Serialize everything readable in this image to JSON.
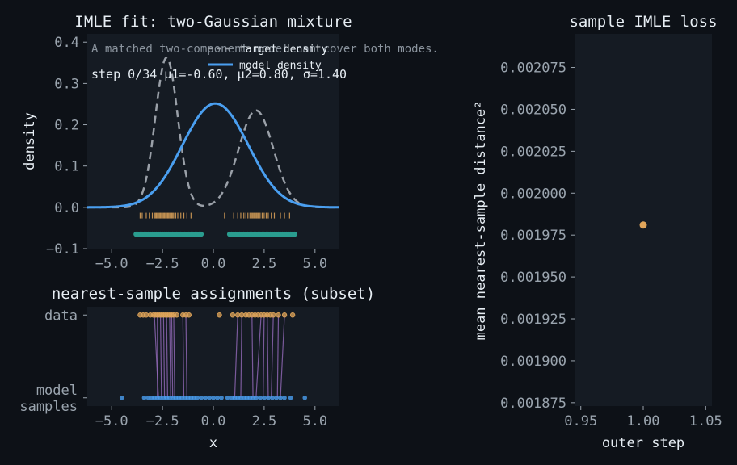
{
  "colors": {
    "background": "#0d1117",
    "axes_bg": "#151b23",
    "target": "#9aa0a8",
    "model": "#4a9ff0",
    "data_points": "#e0a55a",
    "model_samples_marks": "#2a9d8f",
    "assignment_lines": "#9c6fc4",
    "loss_point": "#e0a55a",
    "text": "#e6edf3",
    "tick": "#9aa4ae"
  },
  "chart_data": [
    {
      "id": "density",
      "type": "line",
      "title": "IMLE fit: two-Gaussian mixture",
      "xlabel": "",
      "ylabel": "density",
      "xlim": [
        -6.2,
        6.2
      ],
      "ylim": [
        -0.1,
        0.42
      ],
      "xticks": [
        -5.0,
        -2.5,
        0.0,
        2.5,
        5.0
      ],
      "xtick_labels": [
        "−5.0",
        "−2.5",
        "0.0",
        "2.5",
        "5.0"
      ],
      "yticks": [
        -0.1,
        0.0,
        0.1,
        0.2,
        0.3,
        0.4
      ],
      "ytick_labels": [
        "−0.1",
        "0.0",
        "0.1",
        "0.2",
        "0.3",
        "0.4"
      ],
      "legend_position": "top-center",
      "annotation": "A matched two-component model can cover both modes.",
      "status_text": "step 0/34  μ1=-0.60, μ2=0.80, σ=1.40",
      "series": [
        {
          "name": "target density",
          "style": "dashed",
          "components": [
            {
              "weight": 0.5,
              "mean": -2.3,
              "sd": 0.55
            },
            {
              "weight": 0.5,
              "mean": 2.1,
              "sd": 0.85
            }
          ]
        },
        {
          "name": "model density",
          "style": "solid",
          "components": [
            {
              "weight": 0.5,
              "mean": -0.6,
              "sd": 1.4
            },
            {
              "weight": 0.5,
              "mean": 0.8,
              "sd": 1.4
            }
          ]
        }
      ],
      "rug_data_y": -0.02,
      "rug_data_x": [
        -3.6,
        -3.5,
        -3.3,
        -3.15,
        -3.0,
        -2.9,
        -2.85,
        -2.8,
        -2.75,
        -2.7,
        -2.65,
        -2.6,
        -2.55,
        -2.5,
        -2.45,
        -2.4,
        -2.35,
        -2.3,
        -2.25,
        -2.2,
        -2.15,
        -2.1,
        -2.05,
        -2.0,
        -1.95,
        -1.85,
        -1.75,
        -1.6,
        -1.45,
        -1.3,
        -1.1,
        0.55,
        1.0,
        1.2,
        1.35,
        1.5,
        1.6,
        1.7,
        1.8,
        1.85,
        1.9,
        1.95,
        2.0,
        2.05,
        2.1,
        2.15,
        2.2,
        2.25,
        2.3,
        2.4,
        2.5,
        2.6,
        2.7,
        2.85,
        3.0,
        3.3,
        3.5,
        3.75
      ],
      "model_samples_y": -0.065,
      "model_samples_x": [
        -3.8,
        -3.7,
        -3.6,
        -3.5,
        -3.4,
        -3.3,
        -3.2,
        -3.1,
        -3.0,
        -2.9,
        -2.8,
        -2.7,
        -2.6,
        -2.5,
        -2.4,
        -2.3,
        -2.2,
        -2.1,
        -2.0,
        -1.9,
        -1.8,
        -1.7,
        -1.6,
        -1.5,
        -1.4,
        -1.3,
        -1.2,
        -1.1,
        -1.0,
        -0.9,
        -0.8,
        -0.7,
        -0.6,
        0.8,
        0.9,
        1.0,
        1.1,
        1.2,
        1.3,
        1.4,
        1.5,
        1.6,
        1.7,
        1.8,
        1.9,
        2.0,
        2.1,
        2.2,
        2.3,
        2.4,
        2.5,
        2.6,
        2.7,
        2.8,
        2.9,
        3.0,
        3.1,
        3.2,
        3.3,
        3.4,
        3.5,
        3.6,
        3.7,
        3.8,
        3.9,
        4.0
      ]
    },
    {
      "id": "assignments",
      "type": "scatter",
      "title": "nearest-sample assignments (subset)",
      "xlabel": "x",
      "ylabel": "",
      "xlim": [
        -6.2,
        6.2
      ],
      "ylim": [
        -0.1,
        1.1
      ],
      "xticks": [
        -5.0,
        -2.5,
        0.0,
        2.5,
        5.0
      ],
      "xtick_labels": [
        "−5.0",
        "−2.5",
        "0.0",
        "2.5",
        "5.0"
      ],
      "ytick_labels": [
        {
          "lines": [
            "data"
          ],
          "y": 1
        },
        {
          "lines": [
            "model",
            "samples"
          ],
          "y": 0
        }
      ],
      "data_x": [
        -3.6,
        -3.45,
        -3.3,
        -3.1,
        -2.95,
        -2.85,
        -2.75,
        -2.65,
        -2.55,
        -2.45,
        -2.35,
        -2.25,
        -2.15,
        -2.05,
        -1.95,
        -1.8,
        -1.5,
        -1.35,
        -1.2,
        0.3,
        0.95,
        1.2,
        1.4,
        1.6,
        1.75,
        1.9,
        2.05,
        2.2,
        2.35,
        2.5,
        2.65,
        2.8,
        2.95,
        3.2,
        3.5,
        3.9
      ],
      "model_x": [
        -4.5,
        -3.4,
        -3.2,
        -3.05,
        -2.9,
        -2.75,
        -2.6,
        -2.45,
        -2.3,
        -2.15,
        -2.0,
        -1.85,
        -1.7,
        -1.55,
        -1.4,
        -1.25,
        -1.1,
        -0.95,
        -0.8,
        -0.6,
        -0.4,
        -0.2,
        0.0,
        0.2,
        0.4,
        0.7,
        0.9,
        1.05,
        1.2,
        1.35,
        1.5,
        1.65,
        1.8,
        1.95,
        2.1,
        2.3,
        2.5,
        2.7,
        2.9,
        3.1,
        3.3,
        3.5,
        3.8,
        4.5
      ],
      "links": [
        [
          -2.9,
          -2.7
        ],
        [
          -2.75,
          -2.75
        ],
        [
          -2.6,
          -2.55
        ],
        [
          -2.45,
          -2.4
        ],
        [
          -2.3,
          -2.25
        ],
        [
          -2.15,
          -2.1
        ],
        [
          -2.05,
          -2.0
        ],
        [
          -1.95,
          -1.9
        ],
        [
          -1.5,
          -1.45
        ],
        [
          -1.35,
          -1.3
        ],
        [
          1.2,
          1.05
        ],
        [
          1.4,
          1.35
        ],
        [
          1.9,
          1.95
        ],
        [
          2.35,
          2.1
        ],
        [
          2.5,
          2.45
        ],
        [
          2.65,
          2.7
        ],
        [
          2.95,
          2.85
        ],
        [
          3.2,
          3.15
        ],
        [
          3.5,
          3.3
        ]
      ]
    },
    {
      "id": "loss",
      "type": "scatter",
      "title": "sample IMLE loss",
      "xlabel": "outer step",
      "ylabel": "mean nearest-sample distance²",
      "xlim": [
        0.945,
        1.055
      ],
      "ylim": [
        0.001873,
        0.002095
      ],
      "xticks": [
        0.95,
        1.0,
        1.05
      ],
      "xtick_labels": [
        "0.95",
        "1.00",
        "1.05"
      ],
      "yticks": [
        0.001875,
        0.0019,
        0.001925,
        0.00195,
        0.001975,
        0.002,
        0.002025,
        0.00205,
        0.002075
      ],
      "ytick_labels": [
        "0.001875",
        "0.001900",
        "0.001925",
        "0.001950",
        "0.001975",
        "0.002000",
        "0.002025",
        "0.002050",
        "0.002075"
      ],
      "points": [
        {
          "x": 1.0,
          "y": 0.001981
        }
      ]
    }
  ]
}
